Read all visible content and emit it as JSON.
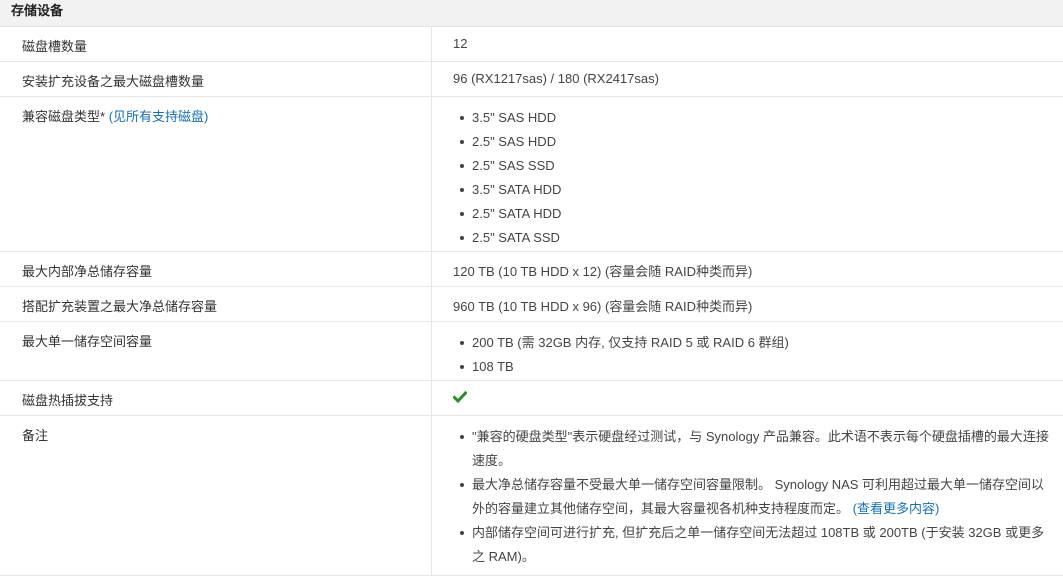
{
  "header": {
    "title": "存储设备"
  },
  "rows": {
    "drive_bays": {
      "label": "磁盘槽数量",
      "value": "12"
    },
    "max_bays": {
      "label": "安装扩充设备之最大磁盘槽数量",
      "value": "96 (RX1217sas) / 180 (RX2417sas)"
    },
    "compatible": {
      "label": "兼容磁盘类型*",
      "link": "(见所有支持磁盘)",
      "items": [
        "3.5\" SAS HDD",
        "2.5\" SAS HDD",
        "2.5\" SAS SSD",
        "3.5\" SATA HDD",
        "2.5\" SATA HDD",
        "2.5\" SATA SSD"
      ]
    },
    "max_internal": {
      "label": "最大内部净总储存容量",
      "value": "120 TB (10 TB HDD x 12) (容量会随 RAID种类而异)"
    },
    "max_expansion": {
      "label": "搭配扩充装置之最大净总储存容量",
      "value": "960 TB (10 TB HDD x 96) (容量会随 RAID种类而异)"
    },
    "max_volume": {
      "label": "最大单一储存空间容量",
      "items": [
        "200 TB (需 32GB 内存, 仅支持 RAID 5 或 RAID 6 群组)",
        "108 TB"
      ]
    },
    "hot_swap": {
      "label": "磁盘热插拔支持",
      "value_icon": "check-icon",
      "value_color": "#2e8b2e"
    },
    "notes": {
      "label": "备注",
      "item1": "\"兼容的硬盘类型\"表示硬盘经过测试，与 Synology 产品兼容。此术语不表示每个硬盘插槽的最大连接速度。",
      "item2_text": "最大净总储存容量不受最大单一储存空间容量限制。 Synology NAS 可利用超过最大单一储存空间以外的容量建立其他储存空间，其最大容量视各机种支持程度而定。",
      "item2_link": "(查看更多内容)",
      "item3": "内部储存空间可进行扩充, 但扩充后之单一储存空间无法超过 108TB 或 200TB (于安装 32GB 或更多之 RAM)。"
    }
  }
}
